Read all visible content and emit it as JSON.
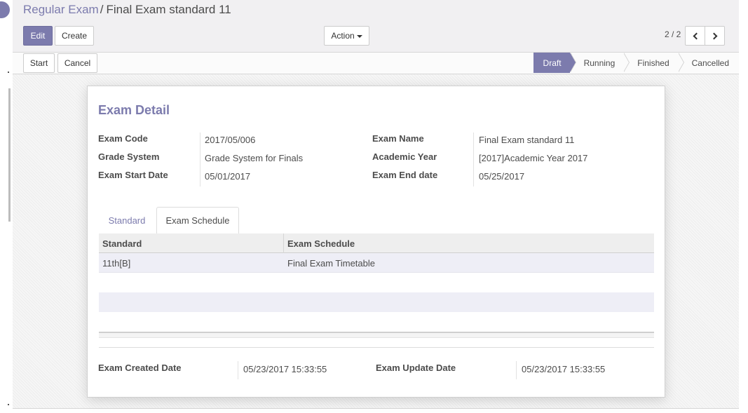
{
  "breadcrumb": {
    "parent": "Regular Exam",
    "separator": "/",
    "current": "Final Exam standard 11"
  },
  "toolbar": {
    "edit_label": "Edit",
    "create_label": "Create",
    "action_label": "Action"
  },
  "pager": {
    "value": "2 / 2"
  },
  "header_buttons": {
    "start_label": "Start",
    "cancel_label": "Cancel"
  },
  "stages": [
    {
      "label": "Draft",
      "active": true
    },
    {
      "label": "Running",
      "active": false
    },
    {
      "label": "Finished",
      "active": false
    },
    {
      "label": "Cancelled",
      "active": false
    }
  ],
  "form": {
    "title": "Exam Detail",
    "left_fields": [
      {
        "label": "Exam Code",
        "value": "2017/05/006"
      },
      {
        "label": "Grade System",
        "value": "Grade System for Finals"
      },
      {
        "label": "Exam Start Date",
        "value": "05/01/2017"
      }
    ],
    "right_fields": [
      {
        "label": "Exam Name",
        "value": "Final Exam standard 11"
      },
      {
        "label": "Academic Year",
        "value": "[2017]Academic Year 2017"
      },
      {
        "label": "Exam End date",
        "value": "05/25/2017"
      }
    ],
    "tabs": [
      {
        "label": "Standard"
      },
      {
        "label": "Exam Schedule"
      }
    ],
    "table": {
      "columns": [
        "Standard",
        "Exam Schedule"
      ],
      "rows": [
        {
          "standard": "11th[B]",
          "schedule": "Final Exam Timetable"
        }
      ]
    },
    "footer_fields": [
      {
        "label": "Exam Created Date",
        "value": "05/23/2017 15:33:55"
      },
      {
        "label": "Exam Update Date",
        "value": "05/23/2017 15:33:55"
      }
    ]
  },
  "colors": {
    "accent": "#7c7bad",
    "row_highlight": "#eeeef6"
  }
}
